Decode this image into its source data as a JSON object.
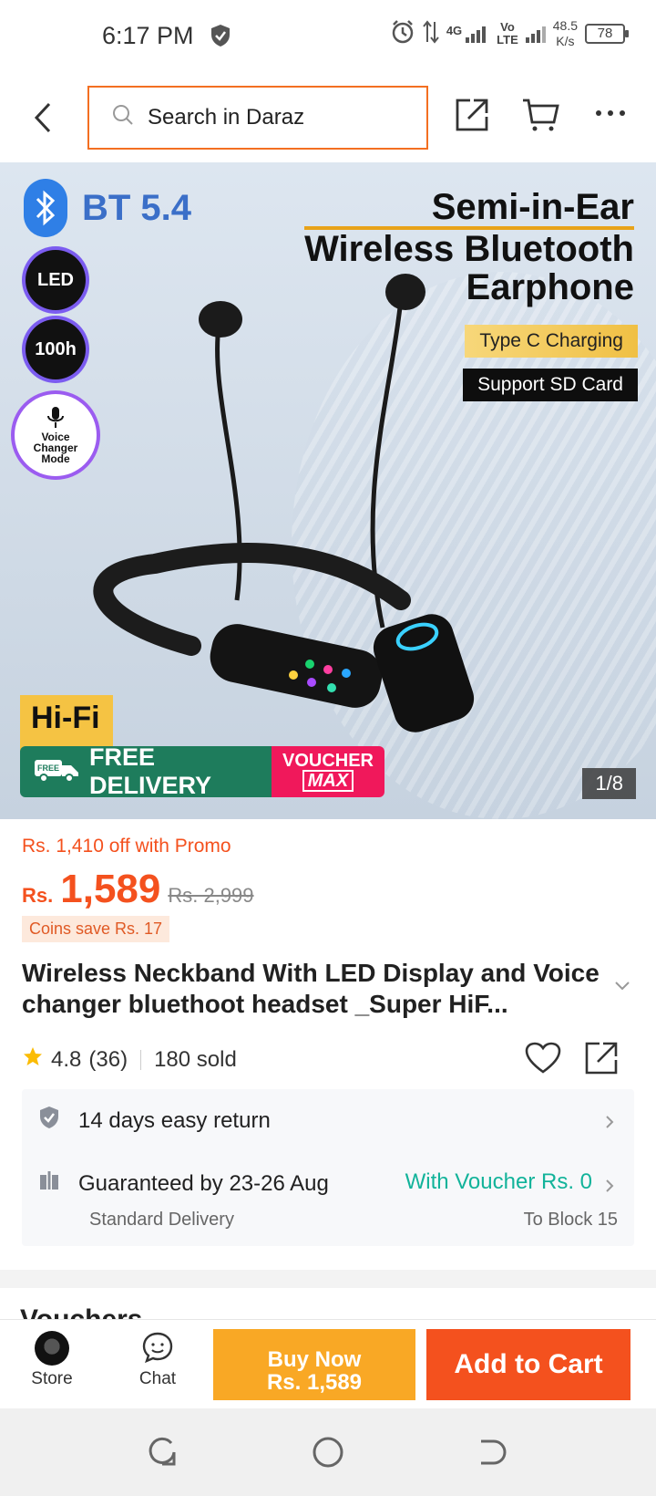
{
  "status_bar": {
    "time": "6:17 PM",
    "net1_top": "4G",
    "net2_top": "Vo",
    "net2_bottom": "LTE",
    "speed_value": "48.5",
    "speed_unit": "K/s",
    "battery": "78"
  },
  "header": {
    "search_placeholder": "Search in Daraz"
  },
  "gallery": {
    "bt_label": "BT 5.4",
    "badge_led": "LED",
    "badge_hours": "100h",
    "badge_voice_l1": "Voice",
    "badge_voice_l2": "Changer",
    "badge_voice_l3": "Mode",
    "headline_l1": "Semi-in-Ear",
    "headline_l2": "Wireless Bluetooth",
    "headline_l3": "Earphone",
    "pill_typec": "Type C Charging",
    "pill_sd": "Support SD Card",
    "hifi": "Hi-Fi",
    "free_tag": "FREE",
    "free_delivery": "FREE DELIVERY",
    "voucher_l1": "VOUCHER",
    "voucher_l2": "MAX",
    "pager": "1/8"
  },
  "product": {
    "promo": "Rs. 1,410 off with Promo",
    "currency": "Rs.",
    "price": "1,589",
    "old_price": "Rs. 2,999",
    "coins": "Coins save Rs. 17",
    "title": "Wireless Neckband With LED Display and Voice changer bluethoot headset _Super HiF...",
    "rating": "4.8",
    "reviews": "(36)",
    "sold": "180 sold"
  },
  "info": {
    "return": "14 days easy return",
    "guarantee": "Guaranteed by 23-26 Aug",
    "voucher": "With Voucher Rs. 0",
    "delivery_type": "Standard Delivery",
    "location": "To Block 15"
  },
  "next_section_peek": "Vouchers",
  "action_bar": {
    "store": "Store",
    "chat": "Chat",
    "buy_now_l1": "Buy Now",
    "buy_now_l2": "Rs. 1,589",
    "add_to_cart": "Add to Cart"
  },
  "colors": {
    "brand_orange": "#f4511e",
    "buy_yellow": "#f9a825",
    "voucher_teal": "#12b39a"
  }
}
